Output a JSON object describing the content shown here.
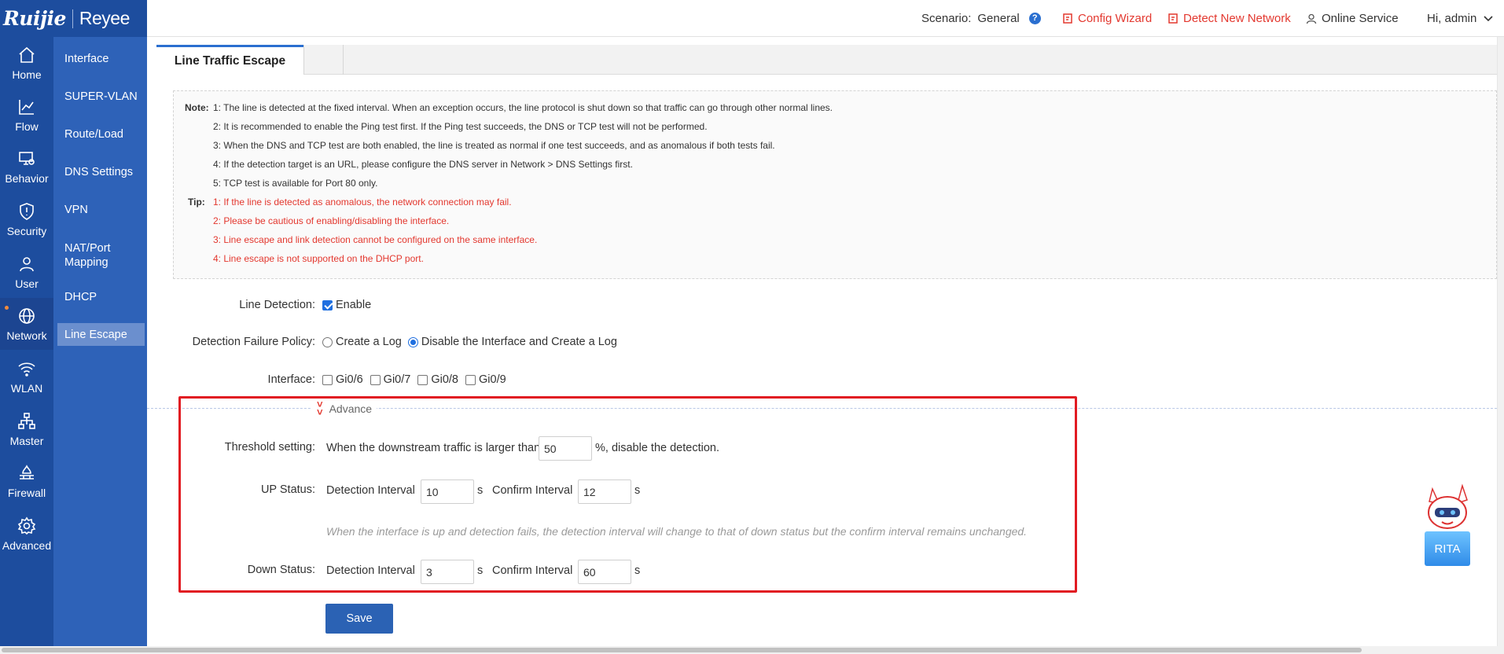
{
  "logo": {
    "brand": "Ruijie",
    "brand2": "Reyee"
  },
  "header": {
    "scenario_label": "Scenario:",
    "scenario_value": "General",
    "config_wizard": "Config Wizard",
    "detect_network": "Detect New Network",
    "online_service": "Online Service",
    "user_greeting": "Hi, admin"
  },
  "rail": [
    {
      "label": "Home",
      "icon": "home-icon"
    },
    {
      "label": "Flow",
      "icon": "chart-icon"
    },
    {
      "label": "Behavior",
      "icon": "monitor-icon"
    },
    {
      "label": "Security",
      "icon": "shield-icon"
    },
    {
      "label": "User",
      "icon": "user-icon"
    },
    {
      "label": "Network",
      "icon": "globe-icon",
      "active": true
    },
    {
      "label": "WLAN",
      "icon": "wifi-icon"
    },
    {
      "label": "Master",
      "icon": "topology-icon"
    },
    {
      "label": "Firewall",
      "icon": "firewall-icon"
    },
    {
      "label": "Advanced",
      "icon": "gear-icon"
    }
  ],
  "submenu": [
    {
      "label": "Interface"
    },
    {
      "label": "SUPER-VLAN"
    },
    {
      "label": "Route/Load"
    },
    {
      "label": "DNS Settings"
    },
    {
      "label": "VPN"
    },
    {
      "label": "NAT/Port Mapping"
    },
    {
      "label": "DHCP"
    },
    {
      "label": "Line Escape",
      "active": true
    }
  ],
  "tab": {
    "label": "Line Traffic Escape"
  },
  "notes": {
    "note_head": "Note:",
    "notes": [
      "1: The line is detected at the fixed interval. When an exception occurs, the line protocol is shut down so that traffic can go through other normal lines.",
      "2: It is recommended to enable the Ping test first. If the Ping test succeeds, the DNS or TCP test will not be performed.",
      "3: When the DNS and TCP test are both enabled, the line is treated as normal if one test succeeds, and as anomalous if both tests fail.",
      "4: If the detection target is an URL, please configure the DNS server in Network > DNS Settings first.",
      "5: TCP test is available for Port 80 only."
    ],
    "tip_head": "Tip:",
    "tips": [
      "1: If the line is detected as anomalous, the network connection may fail.",
      "2: Please be cautious of enabling/disabling the interface.",
      "3: Line escape and link detection cannot be configured on the same interface.",
      "4: Line escape is not supported on the DHCP port."
    ]
  },
  "form": {
    "line_detection_label": "Line Detection:",
    "enable_label": "Enable",
    "enable_checked": true,
    "policy_label": "Detection Failure Policy:",
    "policy_options": [
      "Create a Log",
      "Disable the Interface and Create a Log"
    ],
    "policy_selected": "Disable the Interface and Create a Log",
    "interface_label": "Interface:",
    "interfaces": [
      "Gi0/6",
      "Gi0/7",
      "Gi0/8",
      "Gi0/9"
    ],
    "advance_label": "Advance",
    "threshold_label": "Threshold setting:",
    "threshold_prefix": "When the downstream traffic is larger than",
    "threshold_value": "50",
    "threshold_suffix": "%, disable the detection.",
    "up_status_label": "UP Status:",
    "detection_interval_label": "Detection Interval",
    "confirm_interval_label": "Confirm Interval",
    "unit_s": "s",
    "up_detection_interval": "10",
    "up_confirm_interval": "12",
    "up_hint": "When the interface is up and detection fails, the detection interval will change to that of down status but the confirm interval remains unchanged.",
    "down_status_label": "Down Status:",
    "down_detection_interval": "3",
    "down_confirm_interval": "60",
    "save_label": "Save"
  },
  "assistant": {
    "label": "RITA"
  },
  "colors": {
    "rail": "#1d4d9e",
    "submenu": "#2e62b8",
    "accent_red": "#e3382f",
    "highlight_box": "#e11b22",
    "save_button": "#2b62b4"
  }
}
